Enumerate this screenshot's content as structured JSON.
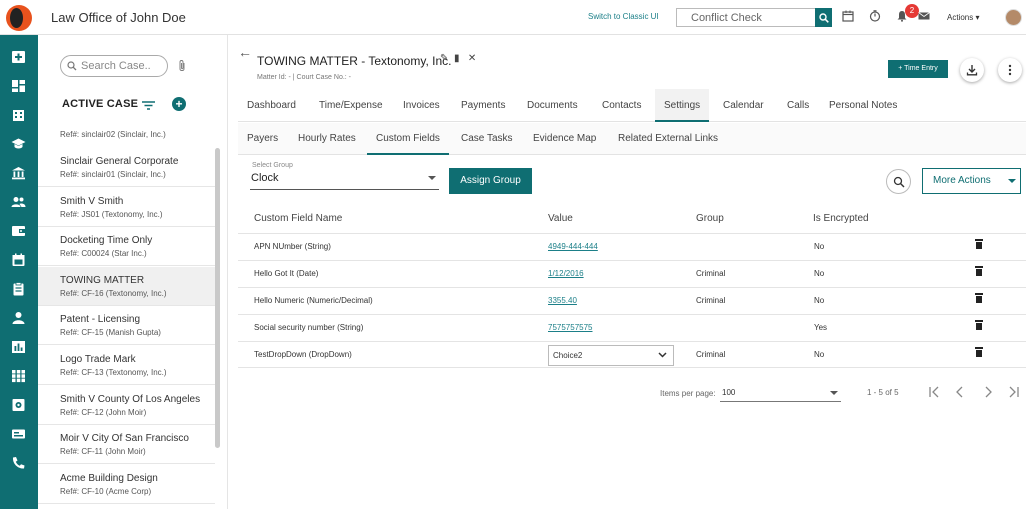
{
  "header": {
    "firm_name": "Law Office of John Doe",
    "switch_link": "Switch to Classic UI",
    "conflict_placeholder": "Conflict Check",
    "notification_count": "2",
    "actions_label": "Actions"
  },
  "sidebar": {
    "search_placeholder": "Search Case..",
    "active_case_label": "ACTIVE CASE",
    "add_symbol": "+",
    "partial_ref": "Ref#: sinclair02 (Sinclair, Inc.)",
    "cases": [
      {
        "name": "Sinclair General Corporate",
        "ref": "Ref#: sinclair01 (Sinclair, Inc.)"
      },
      {
        "name": "Smith V Smith",
        "ref": "Ref#: JS01 (Textonomy, Inc.)"
      },
      {
        "name": "Docketing Time Only",
        "ref": "Ref#: C00024 (Star Inc.)"
      },
      {
        "name": "TOWING MATTER",
        "ref": "Ref#: CF-16 (Textonomy, Inc.)"
      },
      {
        "name": "Patent - Licensing",
        "ref": "Ref#: CF-15 (Manish Gupta)"
      },
      {
        "name": "Logo Trade Mark",
        "ref": "Ref#: CF-13 (Textonomy, Inc.)"
      },
      {
        "name": "Smith V County Of Los Angeles",
        "ref": "Ref#: CF-12 (John Moir)"
      },
      {
        "name": "Moir V City Of San Francisco",
        "ref": "Ref#: CF-11 (John Moir)"
      },
      {
        "name": "Acme Building Design",
        "ref": "Ref#: CF-10 (Acme Corp)"
      }
    ],
    "selected_index": 3
  },
  "matter": {
    "title": "TOWING MATTER - Textonomy, Inc.",
    "subtitle": "Matter Id: - | Court Case No.: -",
    "time_entry_label": "+  Time Entry"
  },
  "tabs": [
    "Dashboard",
    "Time/Expense",
    "Invoices",
    "Payments",
    "Documents",
    "Contacts",
    "Settings",
    "Calendar",
    "Calls",
    "Personal Notes"
  ],
  "active_tab": "Settings",
  "subtabs": [
    "Payers",
    "Hourly Rates",
    "Custom Fields",
    "Case Tasks",
    "Evidence Map",
    "Related External Links"
  ],
  "active_subtab": "Custom Fields",
  "group": {
    "label": "Select Group",
    "value": "Clock",
    "assign_label": "Assign Group",
    "more_actions_label": "More Actions"
  },
  "table": {
    "headers": [
      "Custom Field Name",
      "Value",
      "Group",
      "Is Encrypted"
    ],
    "rows": [
      {
        "name": "APN NUmber (String)",
        "value": "4949-444-444",
        "group": "",
        "encrypted": "No",
        "type": "link"
      },
      {
        "name": "Hello Got It (Date)",
        "value": "1/12/2016",
        "group": "Criminal",
        "encrypted": "No",
        "type": "link"
      },
      {
        "name": "Hello Numeric (Numeric/Decimal)",
        "value": "3355.40",
        "group": "Criminal",
        "encrypted": "No",
        "type": "link"
      },
      {
        "name": "Social security number (String)",
        "value": "7575757575",
        "group": "",
        "encrypted": "Yes",
        "type": "link"
      },
      {
        "name": "TestDropDown (DropDown)",
        "value": "Choice2",
        "group": "Criminal",
        "encrypted": "No",
        "type": "select"
      }
    ]
  },
  "paginator": {
    "items_per_page_label": "Items per page:",
    "items_per_page": "100",
    "range": "1 - 5 of 5"
  },
  "colors": {
    "brand": "#0f6e72",
    "link": "#1b7f88",
    "badge": "#e53935",
    "logo": "#e8521d"
  }
}
